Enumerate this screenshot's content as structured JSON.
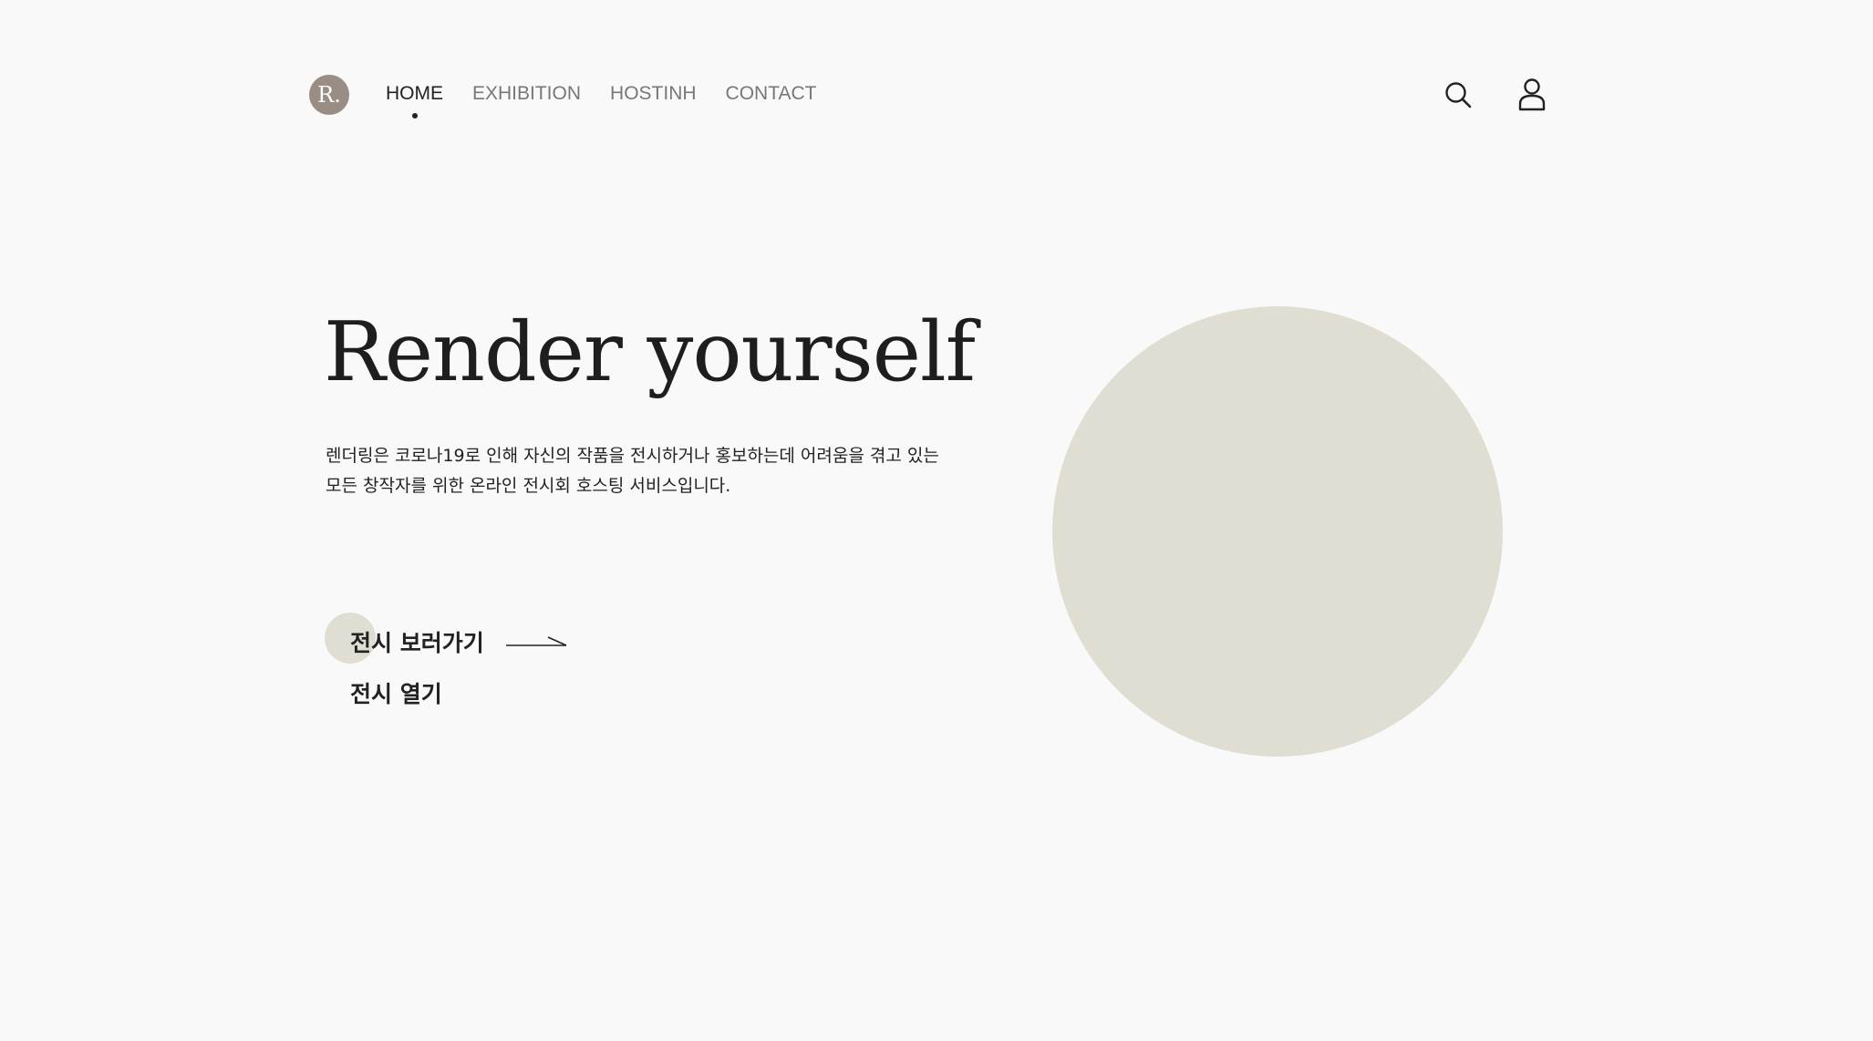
{
  "header": {
    "logo_text": "R.",
    "nav": [
      {
        "label": "HOME",
        "active": true
      },
      {
        "label": "EXHIBITION",
        "active": false
      },
      {
        "label": "HOSTINH",
        "active": false
      },
      {
        "label": "CONTACT",
        "active": false
      }
    ],
    "icons": [
      "search-icon",
      "user-icon"
    ]
  },
  "hero": {
    "title": "Render yourself",
    "description_line1": "렌더링은 코로나19로 인해 자신의 작품을 전시하거나 홍보하는데 어려움을 겪고 있는",
    "description_line2": "모든 창작자를 위한 온라인 전시회 호스팅 서비스입니다.",
    "cta_view": "전시 보러가기",
    "cta_open": "전시 열기"
  },
  "colors": {
    "background": "#f9f9f9",
    "logo": "#9a8d84",
    "accent_circle": "#e0ddd3",
    "text": "#222222",
    "nav_inactive": "#777777"
  }
}
